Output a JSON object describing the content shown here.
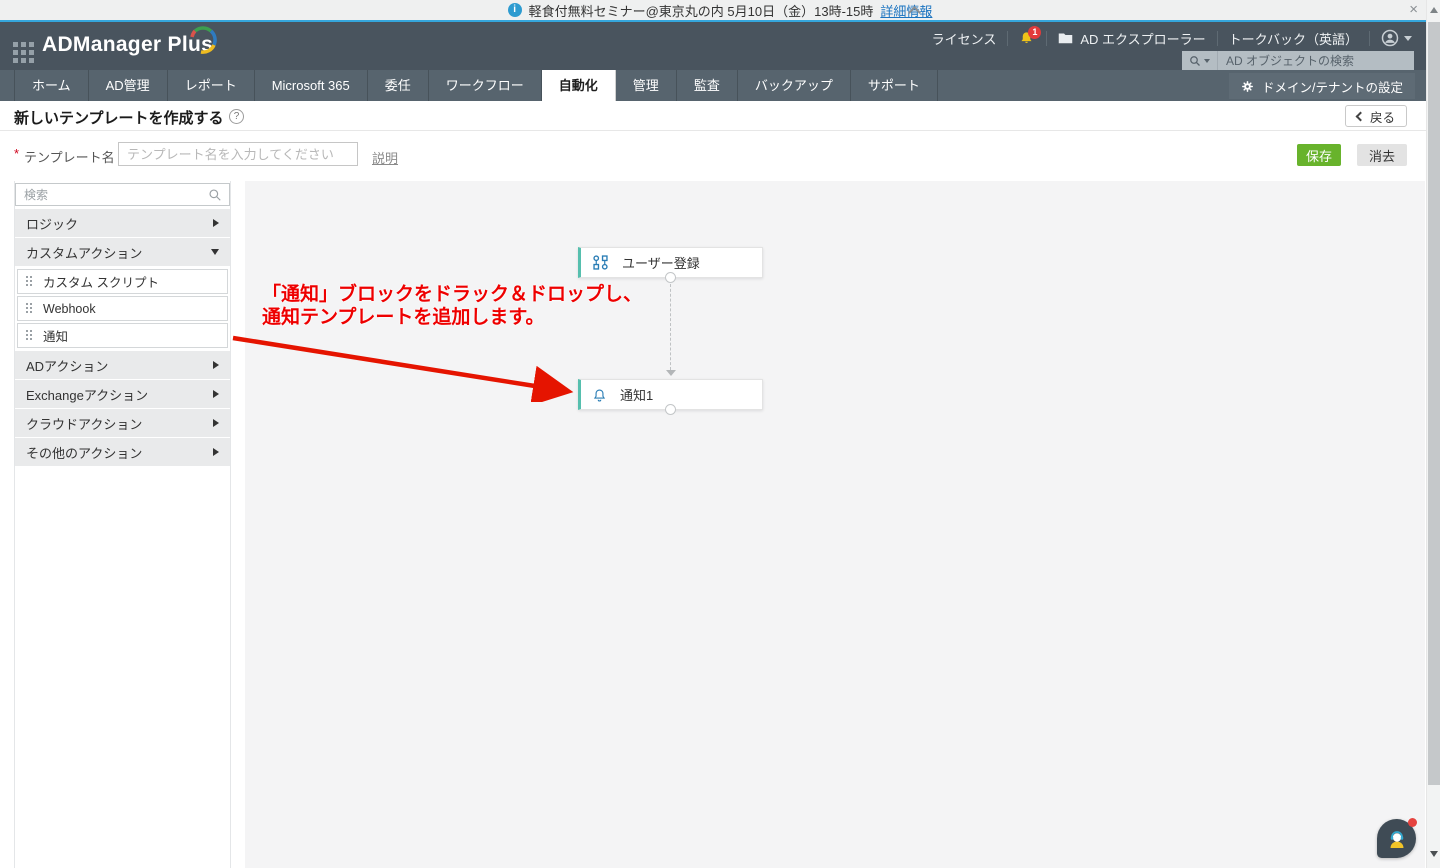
{
  "banner": {
    "text": "軽食付無料セミナー@東京丸の内 5月10日（金）13時-15時",
    "link": "詳細情報",
    "close": "×"
  },
  "header": {
    "app_title": "ADManager Plus",
    "license": "ライセンス",
    "notification_count": "1",
    "ad_explorer": "AD エクスプローラー",
    "talkback": "トークバック（英語）",
    "search_placeholder": "AD オブジェクトの検索"
  },
  "nav": {
    "tabs": [
      {
        "label": "ホーム",
        "active": false
      },
      {
        "label": "AD管理",
        "active": false
      },
      {
        "label": "レポート",
        "active": false
      },
      {
        "label": "Microsoft 365",
        "active": false
      },
      {
        "label": "委任",
        "active": false
      },
      {
        "label": "ワークフロー",
        "active": false
      },
      {
        "label": "自動化",
        "active": true
      },
      {
        "label": "管理",
        "active": false
      },
      {
        "label": "監査",
        "active": false
      },
      {
        "label": "バックアップ",
        "active": false
      },
      {
        "label": "サポート",
        "active": false
      }
    ],
    "domain_settings": "ドメイン/テナントの設定"
  },
  "page": {
    "title": "新しいテンプレートを作成する",
    "help_icon": "?",
    "back_button": "戻る",
    "required_mark": "*",
    "template_name_label": "テンプレート名",
    "template_name_placeholder": "テンプレート名を入力してください",
    "template_name_value": "",
    "description_link": "説明",
    "save_button": "保存",
    "clear_button": "消去"
  },
  "sidebar": {
    "search_placeholder": "検索",
    "groups": [
      {
        "label": "ロジック",
        "expanded": false
      },
      {
        "label": "カスタムアクション",
        "expanded": true
      },
      {
        "label": "ADアクション",
        "expanded": false
      },
      {
        "label": "Exchangeアクション",
        "expanded": false
      },
      {
        "label": "クラウドアクション",
        "expanded": false
      },
      {
        "label": "その他のアクション",
        "expanded": false
      }
    ],
    "custom_actions": [
      "カスタム スクリプト",
      "Webhook",
      "通知"
    ]
  },
  "canvas": {
    "blocks": [
      {
        "label": "ユーザー登録",
        "icon": "workflow-icon"
      },
      {
        "label": "通知1",
        "icon": "bell-icon"
      }
    ],
    "annotation_line1": "「通知」ブロックをドラック＆ドロップし、",
    "annotation_line2": "通知テンプレートを追加します。"
  },
  "colors": {
    "banner_accent": "#35a6dc",
    "header_bg": "#49545e",
    "nav_bg": "#57646e",
    "save_green": "#68b32c",
    "block_teal": "#56bfae",
    "icon_blue": "#2a7db5",
    "annotation_red": "#ee0000"
  }
}
